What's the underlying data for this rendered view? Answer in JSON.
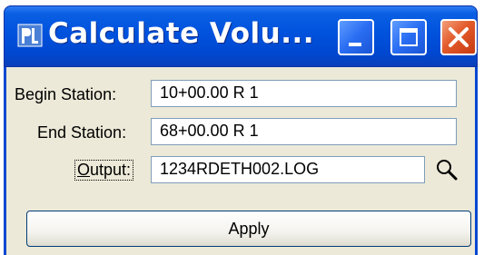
{
  "window": {
    "title": "Calculate Volu...",
    "app_icon": "app-logo-icon",
    "controls": {
      "minimize_icon": "minimize-icon",
      "maximize_icon": "maximize-icon",
      "close_icon": "close-icon"
    }
  },
  "form": {
    "begin_station": {
      "label": "Begin Station:",
      "value": "10+00.00 R 1"
    },
    "end_station": {
      "label": "End Station:",
      "value": "68+00.00 R 1"
    },
    "output": {
      "label_underlined": "O",
      "label_rest": "utput:",
      "value": "1234RDETH002.LOG",
      "browse_icon": "search-icon"
    }
  },
  "actions": {
    "apply_label": "Apply"
  },
  "colors": {
    "titlebar": "#0052dd",
    "close": "#e35a2a",
    "dialog_bg": "#ece9d8"
  }
}
